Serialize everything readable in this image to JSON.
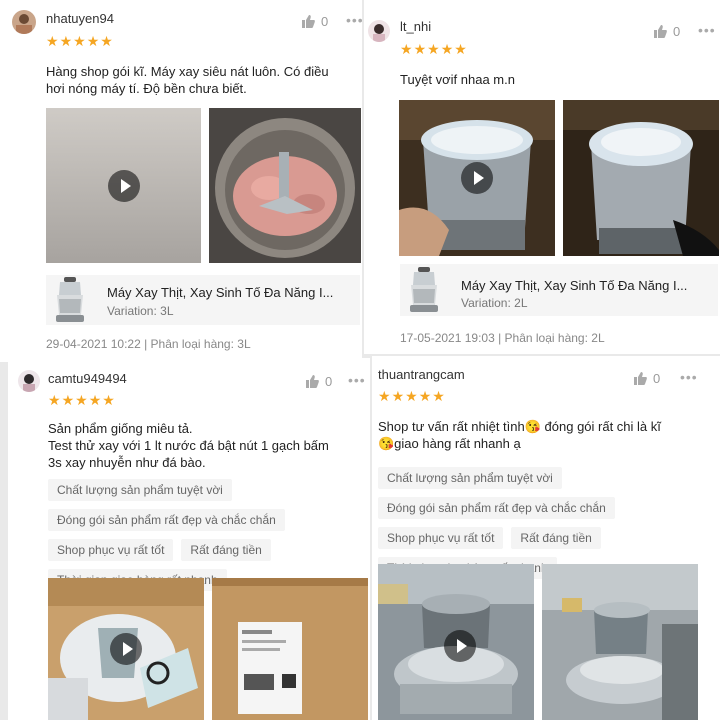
{
  "reviews": [
    {
      "username": "nhatuyen94",
      "like_count": "0",
      "stars_icon": "star-icon",
      "comment_lines": [
        "Hàng shop gói kĩ. Máy xay siêu nát luôn. Có điều",
        "hơi nóng máy tí. Độ bền chưa biết."
      ],
      "product_name": "Máy Xay Thịt, Xay Sinh Tố Đa Năng I...",
      "variation": "Variation: 3L",
      "meta": "29-04-2021 10:22 | Phân loại hàng: 3L"
    },
    {
      "username": "lt_nhi",
      "like_count": "0",
      "comment_lines": [
        "Tuyệt vơif nhaa m.n"
      ],
      "product_name": "Máy Xay Thịt, Xay Sinh Tố Đa Năng I...",
      "variation": "Variation: 2L",
      "meta": "17-05-2021 19:03 | Phân loại hàng: 2L"
    },
    {
      "username": "camtu949494",
      "like_count": "0",
      "comment_lines": [
        "Sản phẩm giống miêu tả.",
        "Test thử xay với 1 lt nước đá  bật nút 1 gạch bấm",
        "3s xay nhuyễn như đá bào."
      ],
      "tags": [
        "Chất lượng sản phẩm tuyệt vời",
        "Đóng gói sản phẩm rất đẹp và chắc chắn",
        "Shop phục vụ rất tốt",
        "Rất đáng tiền",
        "Thời gian giao hàng rất nhanh"
      ]
    },
    {
      "username": "thuantrangcam",
      "like_count": "0",
      "comment_lines": [
        "Shop tư vấn rất nhiệt tình😘 đóng gói rất chi là kĩ",
        "😘giao hàng rất nhanh ạ"
      ],
      "tags": [
        "Chất lượng sản phẩm tuyệt vời",
        "Đóng gói sản phẩm rất đẹp và chắc chắn",
        "Shop phục vụ rất tốt",
        "Rất đáng tiền",
        "Thời gian giao hàng rất nhanh"
      ]
    }
  ],
  "colors": {
    "star": "#f5a623",
    "chip_bg": "#f4f4f4",
    "product_bg": "#f5f5f5"
  },
  "icons": {
    "like": "thumbs-up-icon",
    "more": "more-dots-icon",
    "play": "play-icon"
  }
}
